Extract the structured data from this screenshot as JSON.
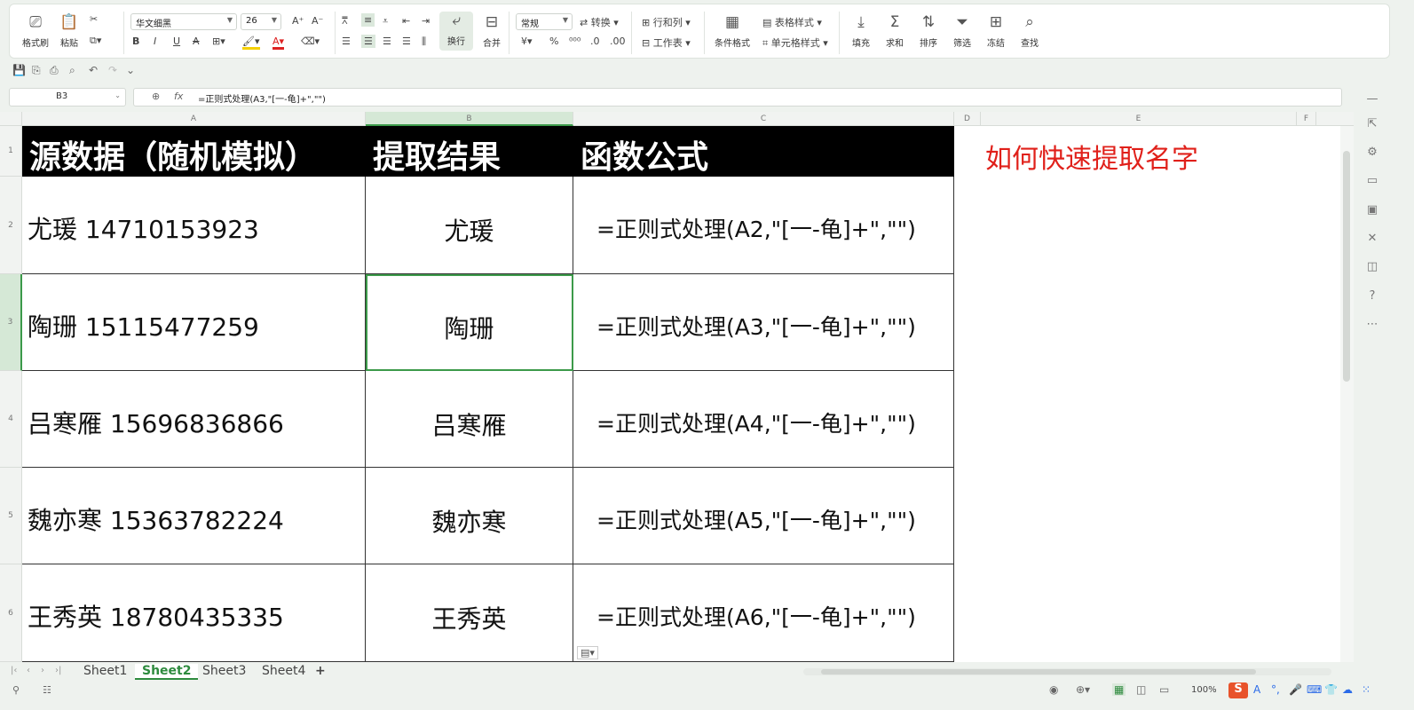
{
  "ribbon": {
    "format_painter": "格式刷",
    "paste": "粘贴",
    "font_name": "华文细黑",
    "font_size": "26",
    "wrap": "换行",
    "merge": "合并",
    "number_format": "常规",
    "convert": "转换",
    "row_col": "行和列",
    "worksheet": "工作表",
    "cond_format": "条件格式",
    "table_style": "表格样式",
    "cell_style": "单元格样式",
    "fill": "填充",
    "sum": "求和",
    "sort": "排序",
    "filter": "筛选",
    "freeze": "冻结",
    "find": "查找"
  },
  "formula_bar": {
    "name_box": "B3",
    "fx": "fx",
    "formula": "=正则式处理(A3,\"[一-龟]+\",\"\")"
  },
  "columns": [
    "A",
    "B",
    "C",
    "D",
    "E",
    "F"
  ],
  "rows": [
    "1",
    "2",
    "3",
    "4",
    "5",
    "6"
  ],
  "table": {
    "headers": [
      "源数据（随机模拟）",
      "提取结果",
      "函数公式"
    ],
    "data": [
      [
        "尤瑗 14710153923",
        "尤瑗",
        "=正则式处理(A2,\"[一-龟]+\",\"\")"
      ],
      [
        "陶珊 15115477259",
        "陶珊",
        "=正则式处理(A3,\"[一-龟]+\",\"\")"
      ],
      [
        "吕寒雁 15696836866",
        "吕寒雁",
        "=正则式处理(A4,\"[一-龟]+\",\"\")"
      ],
      [
        "魏亦寒 15363782224",
        "魏亦寒",
        "=正则式处理(A5,\"[一-龟]+\",\"\")"
      ],
      [
        "王秀英 18780435335",
        "王秀英",
        "=正则式处理(A6,\"[一-龟]+\",\"\")"
      ]
    ]
  },
  "note": "如何快速提取名字",
  "sheets": [
    "Sheet1",
    "Sheet2",
    "Sheet3",
    "Sheet4"
  ],
  "active_sheet": "Sheet2",
  "zoom": "100%",
  "colors": {
    "header_bg": "#000000",
    "note": "#e0201a",
    "active_tab": "#2e8b3e",
    "selection": "#3c9a4a"
  }
}
